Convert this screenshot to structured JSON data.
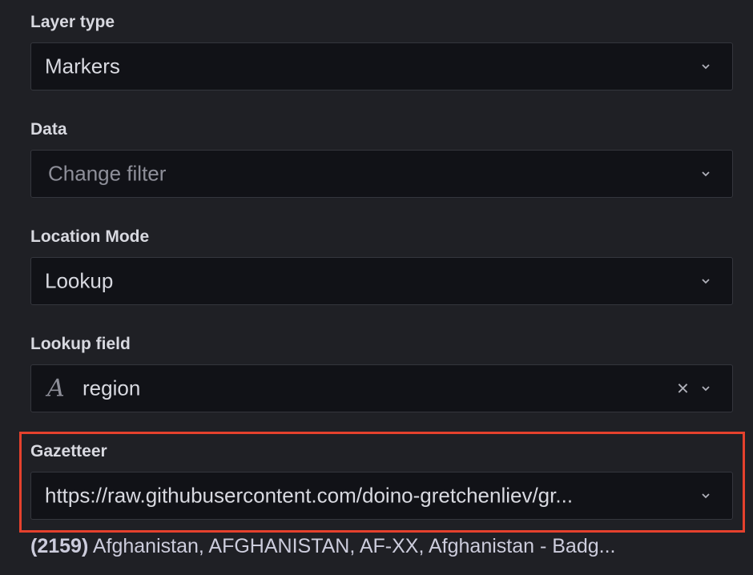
{
  "layer_type": {
    "label": "Layer type",
    "value": "Markers"
  },
  "data": {
    "label": "Data",
    "placeholder": "Change filter"
  },
  "location_mode": {
    "label": "Location Mode",
    "value": "Lookup"
  },
  "lookup_field": {
    "label": "Lookup field",
    "value": "region",
    "type_icon": "A",
    "clear_icon": "×"
  },
  "gazetteer": {
    "label": "Gazetteer",
    "value": "https://raw.githubusercontent.com/doino-gretchenliev/gr...",
    "count": "(2159)",
    "preview": "Afghanistan, AFGHANISTAN, AF-XX, Afghanistan - Badg..."
  },
  "colors": {
    "highlight": "#e5412d",
    "background": "#1f2025",
    "input": "#111217"
  }
}
